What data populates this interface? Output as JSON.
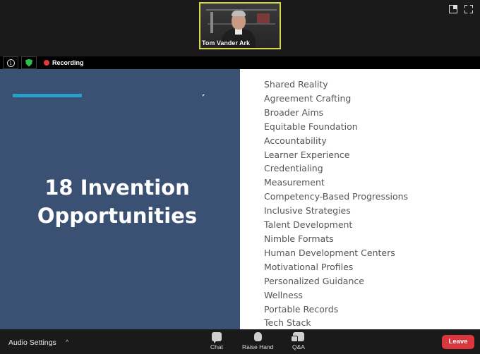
{
  "participant": {
    "name": "Tom Vander Ark"
  },
  "status": {
    "recording_label": "Recording"
  },
  "slide": {
    "title_line1": "18 Invention",
    "title_line2": "Opportunities",
    "items": [
      "Shared Reality",
      "Agreement Crafting",
      "Broader Aims",
      "Equitable Foundation",
      "Accountability",
      "Learner Experience",
      "Credentialing",
      "Measurement",
      "Competency-Based Progressions",
      "Inclusive Strategies",
      "Talent Development",
      "Nimble Formats",
      "Human Development Centers",
      "Motivational Profiles",
      "Personalized Guidance",
      "Wellness",
      "Portable Records",
      "Tech Stack"
    ]
  },
  "toolbar": {
    "audio_settings": "Audio Settings",
    "audio_chevron": "^",
    "chat": "Chat",
    "raise_hand": "Raise Hand",
    "qa": "Q&A",
    "leave": "Leave"
  },
  "icons": {
    "info": "info-icon",
    "security": "shield-icon",
    "recording": "record-dot-icon",
    "gallery": "gallery-view-icon",
    "fullscreen": "fullscreen-icon"
  },
  "colors": {
    "slide_left_bg": "#3a5174",
    "accent": "#29a0c9",
    "active_speaker_border": "#d6d84a",
    "recording": "#e0393e",
    "leave": "#d9363e"
  }
}
